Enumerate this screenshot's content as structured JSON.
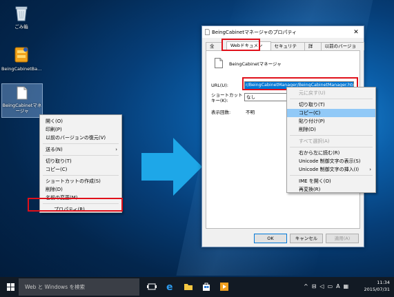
{
  "desktop": {
    "icons": [
      {
        "label": "ごみ箱"
      },
      {
        "label": "BeingCabinetBa..."
      },
      {
        "label": "BeingCabinetマネージャ"
      }
    ]
  },
  "file_context_menu": {
    "items": [
      {
        "label": "開く(O)"
      },
      {
        "label": "印刷(P)"
      },
      {
        "label": "以前のバージョンの復元(V)"
      },
      {
        "label": "送る(N)",
        "submenu": true
      },
      {
        "label": "切り取り(T)"
      },
      {
        "label": "コピー(C)"
      },
      {
        "label": "ショートカットの作成(S)"
      },
      {
        "label": "削除(D)"
      },
      {
        "label": "名前の変更(M)"
      },
      {
        "label": "プロパティ(R)"
      }
    ]
  },
  "dialog": {
    "title": "BeingCabinetマネージャのプロパティ",
    "close_glyph": "✕",
    "tabs": [
      "全般",
      "Webドキュメント",
      "セキュリティ",
      "詳細",
      "以前のバージョン"
    ],
    "active_tab": "Webドキュメント",
    "file_name": "BeingCabinetマネージャ",
    "url_label": "URL(U):",
    "url_value": "r/BeingCabinetManager/BeingCabinetManager.html",
    "shortcut_label_line1": "ショートカット",
    "shortcut_label_line2": "キー(K):",
    "shortcut_value": "なし",
    "visits_label": "表示回数:",
    "visits_value": "不明",
    "buttons": {
      "ok": "OK",
      "cancel": "キャンセル",
      "apply": "適用(A)"
    }
  },
  "edit_context_menu": {
    "items": [
      {
        "label": "元に戻す(U)",
        "disabled": true
      },
      {
        "label": "切り取り(T)"
      },
      {
        "label": "コピー(C)",
        "highlighted": true
      },
      {
        "label": "貼り付け(P)"
      },
      {
        "label": "削除(D)"
      },
      {
        "label": "すべて選択(A)",
        "disabled": true
      },
      {
        "label": "右から左に読む(R)"
      },
      {
        "label": "Unicode 制御文字の表示(S)"
      },
      {
        "label": "Unicode 制御文字の挿入(I)",
        "submenu": true
      },
      {
        "label": "IME を開く(O)"
      },
      {
        "label": "再変換(R)"
      }
    ]
  },
  "taskbar": {
    "search_placeholder": "Web と Windows を検索",
    "time": "11:34",
    "date": "2015/07/31",
    "ime_indicator": "A"
  },
  "colors": {
    "callout": "#e0101a",
    "arrow": "#1ea7e8",
    "selection": "#0078d7"
  }
}
